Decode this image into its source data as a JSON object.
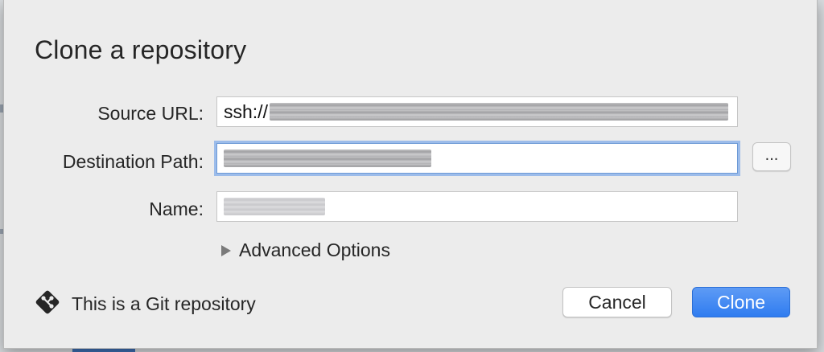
{
  "dialog": {
    "title": "Clone a repository",
    "source_url": {
      "label": "Source URL:",
      "value_visible": "ssh://",
      "redacted": true
    },
    "destination_path": {
      "label": "Destination Path:",
      "redacted": true,
      "focused": true
    },
    "name": {
      "label": "Name:",
      "redacted": true
    },
    "browse_button": {
      "label": "..."
    },
    "advanced_options": {
      "label": "Advanced Options",
      "expanded": false
    },
    "repo_status": {
      "text": "This is a Git repository",
      "icon": "git-diamond-icon"
    },
    "buttons": {
      "cancel": "Cancel",
      "clone": "Clone"
    }
  },
  "colors": {
    "accent": "#2f7cf0",
    "focus_ring": "#9cbcea",
    "dialog_bg": "#ececec"
  }
}
